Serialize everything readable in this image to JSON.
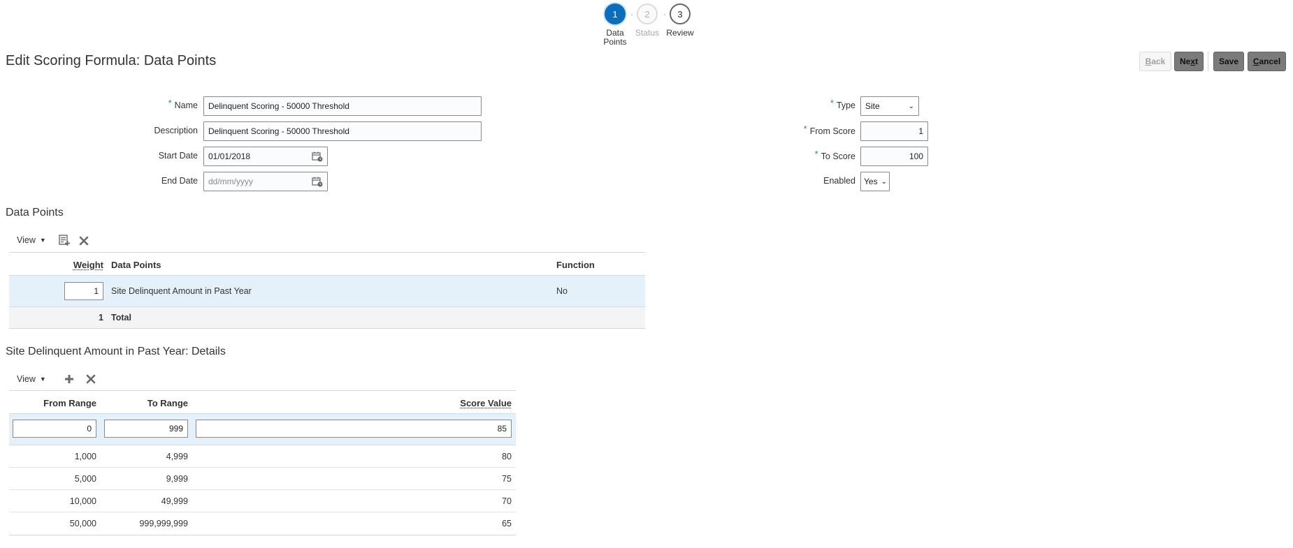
{
  "train": {
    "stops": [
      {
        "number": "1",
        "label_line1": "Data",
        "label_line2": "Points",
        "state": "active"
      },
      {
        "number": "2",
        "label_line1": "Status",
        "label_line2": "",
        "state": "disabled"
      },
      {
        "number": "3",
        "label_line1": "Review",
        "label_line2": "",
        "state": "normal"
      }
    ]
  },
  "header": {
    "title": "Edit Scoring Formula: Data Points",
    "back": {
      "mnemonic": "B",
      "rest": "ack"
    },
    "next": {
      "pre": "Ne",
      "mnemonic": "x",
      "rest": "t"
    },
    "save": "Save",
    "cancel": {
      "mnemonic": "C",
      "rest": "ancel"
    }
  },
  "form": {
    "name": {
      "label": "Name",
      "value": "Delinquent Scoring - 50000 Threshold",
      "required": true
    },
    "description": {
      "label": "Description",
      "value": "Delinquent Scoring - 50000 Threshold"
    },
    "start_date": {
      "label": "Start Date",
      "value": "01/01/2018"
    },
    "end_date": {
      "label": "End Date",
      "placeholder": "dd/mm/yyyy"
    },
    "type": {
      "label": "Type",
      "value": "Site",
      "required": true
    },
    "from_score": {
      "label": "From Score",
      "value": "1",
      "required": true
    },
    "to_score": {
      "label": "To Score",
      "value": "100",
      "required": true
    },
    "enabled": {
      "label": "Enabled",
      "value": "Yes"
    }
  },
  "data_points": {
    "title": "Data Points",
    "view_label": "View",
    "columns": {
      "weight": "Weight",
      "data_points": "Data Points",
      "function": "Function"
    },
    "rows": [
      {
        "weight": "1",
        "data_point": "Site Delinquent Amount in Past Year",
        "function": "No"
      }
    ],
    "total": {
      "value": "1",
      "label": "Total"
    }
  },
  "details": {
    "title": "Site Delinquent Amount in Past Year: Details",
    "view_label": "View",
    "columns": {
      "from_range": "From Range",
      "to_range": "To Range",
      "score_value": "Score Value"
    },
    "edit_row": {
      "from": "0",
      "to": "999",
      "score": "85"
    },
    "rows": [
      {
        "from": "1,000",
        "to": "4,999",
        "score": "80"
      },
      {
        "from": "5,000",
        "to": "9,999",
        "score": "75"
      },
      {
        "from": "10,000",
        "to": "49,999",
        "score": "70"
      },
      {
        "from": "50,000",
        "to": "999,999,999",
        "score": "65"
      }
    ]
  },
  "colors": {
    "accent": "#0a6ebd",
    "selected_row": "#e4f0fa",
    "required_star": "#2a8a8a"
  }
}
